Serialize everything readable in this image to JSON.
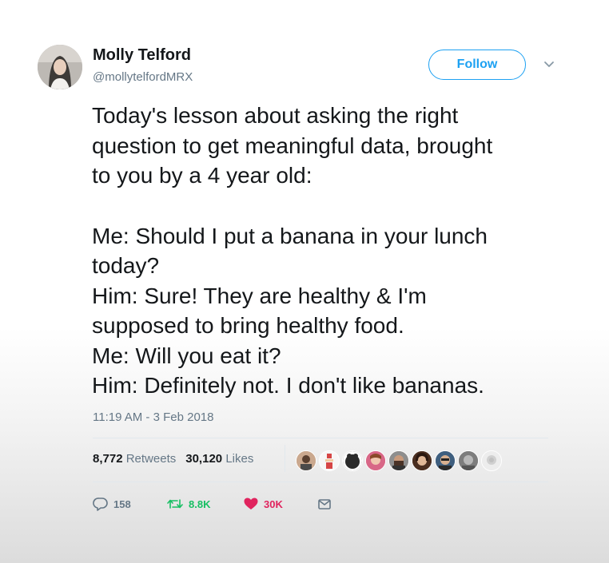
{
  "author": {
    "name": "Molly Telford",
    "handle": "@mollytelfordMRX"
  },
  "follow_label": "Follow",
  "tweet_lines_intro": [
    "Today's lesson about asking the right",
    "question to get meaningful data, brought",
    "to you by a 4 year old:"
  ],
  "tweet_lines_dialogue": [
    "Me: Should I put a banana in your lunch",
    "today?",
    "Him: Sure! They are healthy & I'm",
    "supposed to bring healthy food.",
    "Me: Will you eat it?",
    "Him: Definitely not. I don't like bananas."
  ],
  "timestamp": "11:19 AM - 3 Feb 2018",
  "stats": {
    "retweets_count": "8,772",
    "retweets_label": "Retweets",
    "likes_count": "30,120",
    "likes_label": "Likes"
  },
  "actions": {
    "reply_count": "158",
    "retweet_count": "8.8K",
    "like_count": "30K"
  },
  "colors": {
    "accent": "#1da1f2",
    "retweet": "#17bf63",
    "like": "#e0245e",
    "secondary_text": "#657786"
  },
  "icons": [
    "chevron-down-icon",
    "reply-icon",
    "retweet-icon",
    "heart-icon",
    "envelope-icon"
  ]
}
